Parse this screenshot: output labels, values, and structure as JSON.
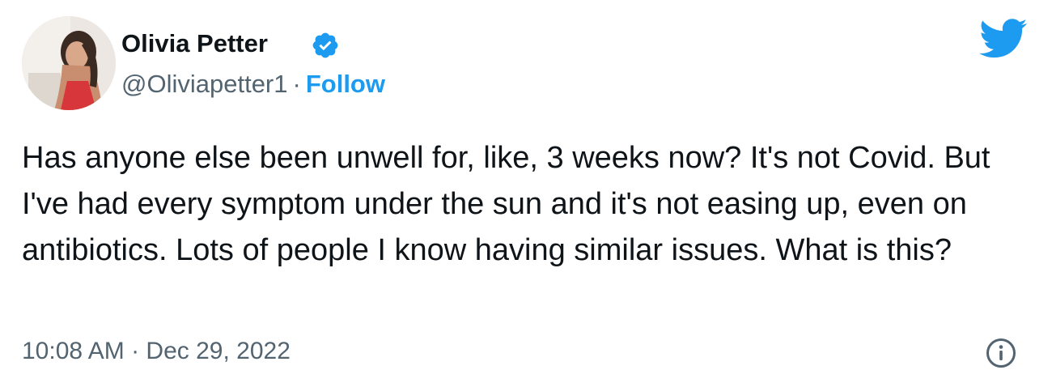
{
  "tweet": {
    "author": {
      "name": "Olivia Petter",
      "handle": "@Oliviapetter1",
      "verified": true,
      "avatar": "profile-photo"
    },
    "separator": "·",
    "follow_label": "Follow",
    "text": "Has anyone else been unwell for, like, 3 weeks now? It's not Covid. But I've had every symptom under the sun and it's not easing up, even on antibiotics. Lots of people I know having similar issues. What is this?",
    "timestamp": "10:08 AM · Dec 29, 2022"
  },
  "icons": {
    "verified": "verified-badge-icon",
    "brand": "twitter-bird-icon",
    "info": "info-icon"
  },
  "colors": {
    "accent": "#1d9bf0",
    "text": "#0f1419",
    "secondary": "#536471"
  }
}
